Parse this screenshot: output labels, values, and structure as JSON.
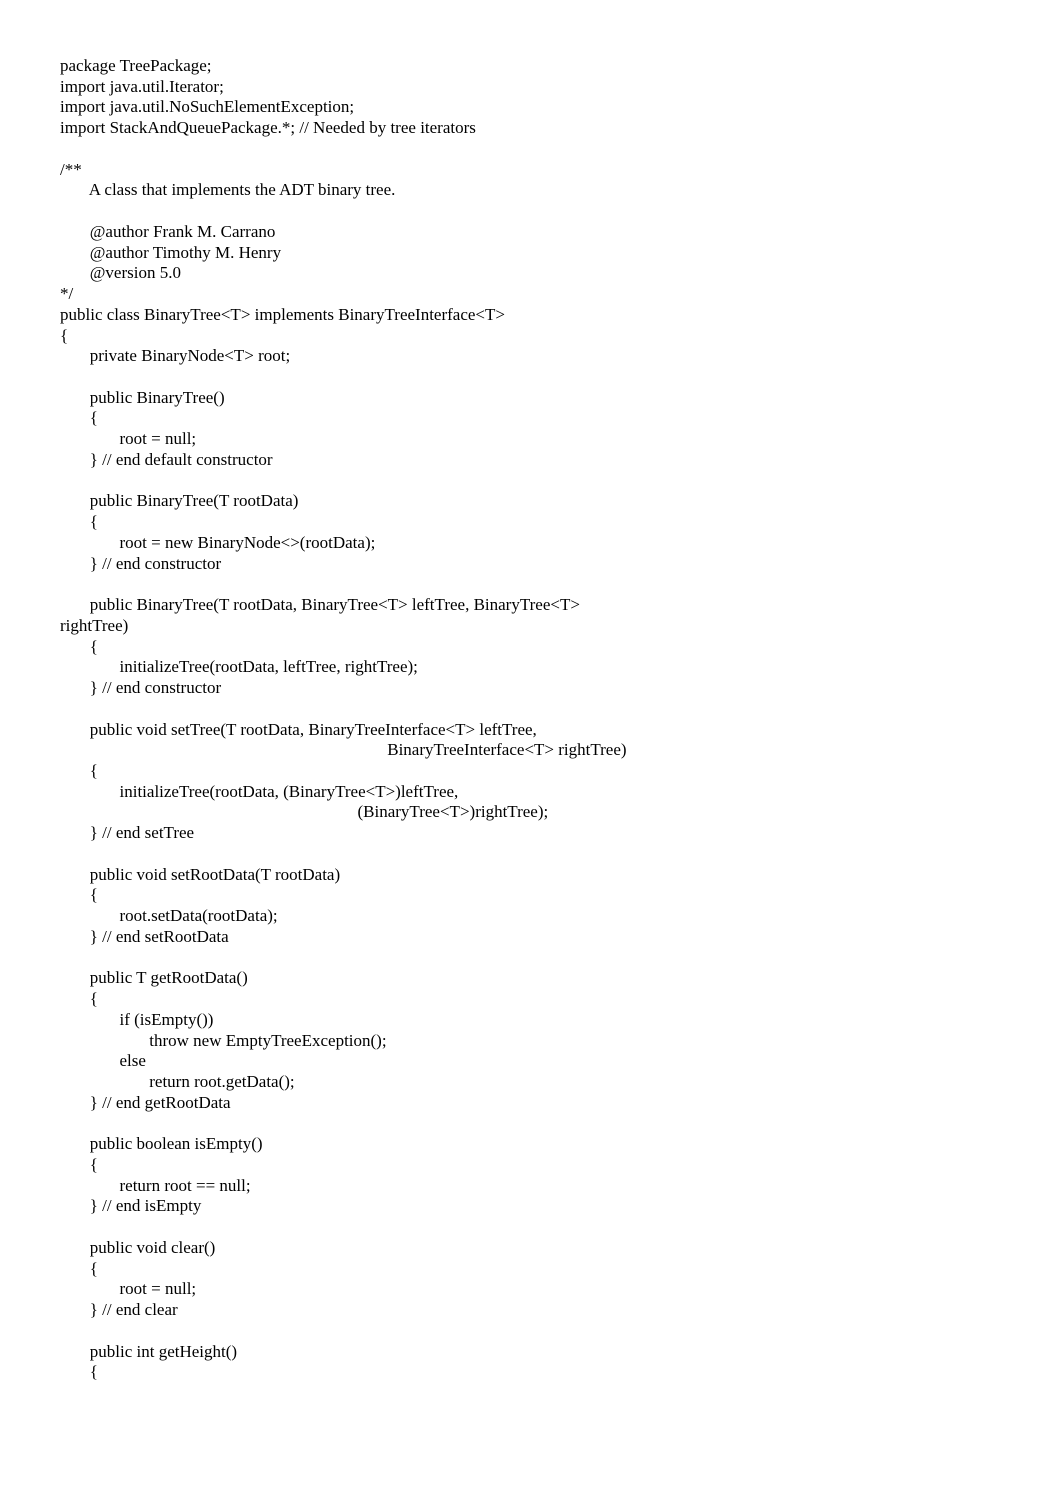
{
  "code": {
    "lines": [
      "package TreePackage;",
      "import java.util.Iterator;",
      "import java.util.NoSuchElementException;",
      "import StackAndQueuePackage.*; // Needed by tree iterators",
      "",
      "/**",
      "       A class that implements the ADT binary tree.",
      "",
      "       @author Frank M. Carrano",
      "       @author Timothy M. Henry",
      "       @version 5.0",
      "*/",
      "public class BinaryTree<T> implements BinaryTreeInterface<T>",
      "{",
      "       private BinaryNode<T> root;",
      "",
      "       public BinaryTree()",
      "       {",
      "              root = null;",
      "       } // end default constructor",
      "",
      "       public BinaryTree(T rootData)",
      "       {",
      "              root = new BinaryNode<>(rootData);",
      "       } // end constructor",
      "",
      "       public BinaryTree(T rootData, BinaryTree<T> leftTree, BinaryTree<T>",
      "rightTree)",
      "       {",
      "              initializeTree(rootData, leftTree, rightTree);",
      "       } // end constructor",
      "",
      "       public void setTree(T rootData, BinaryTreeInterface<T> leftTree,",
      "                                                                             BinaryTreeInterface<T> rightTree)",
      "       {",
      "              initializeTree(rootData, (BinaryTree<T>)leftTree,",
      "                                                                      (BinaryTree<T>)rightTree);",
      "       } // end setTree",
      "",
      "       public void setRootData(T rootData)",
      "       {",
      "              root.setData(rootData);",
      "       } // end setRootData",
      "",
      "       public T getRootData()",
      "       {",
      "              if (isEmpty())",
      "                     throw new EmptyTreeException();",
      "              else",
      "                     return root.getData();",
      "       } // end getRootData",
      "",
      "       public boolean isEmpty()",
      "       {",
      "              return root == null;",
      "       } // end isEmpty",
      "",
      "       public void clear()",
      "       {",
      "              root = null;",
      "       } // end clear",
      "",
      "       public int getHeight()",
      "       {"
    ]
  }
}
